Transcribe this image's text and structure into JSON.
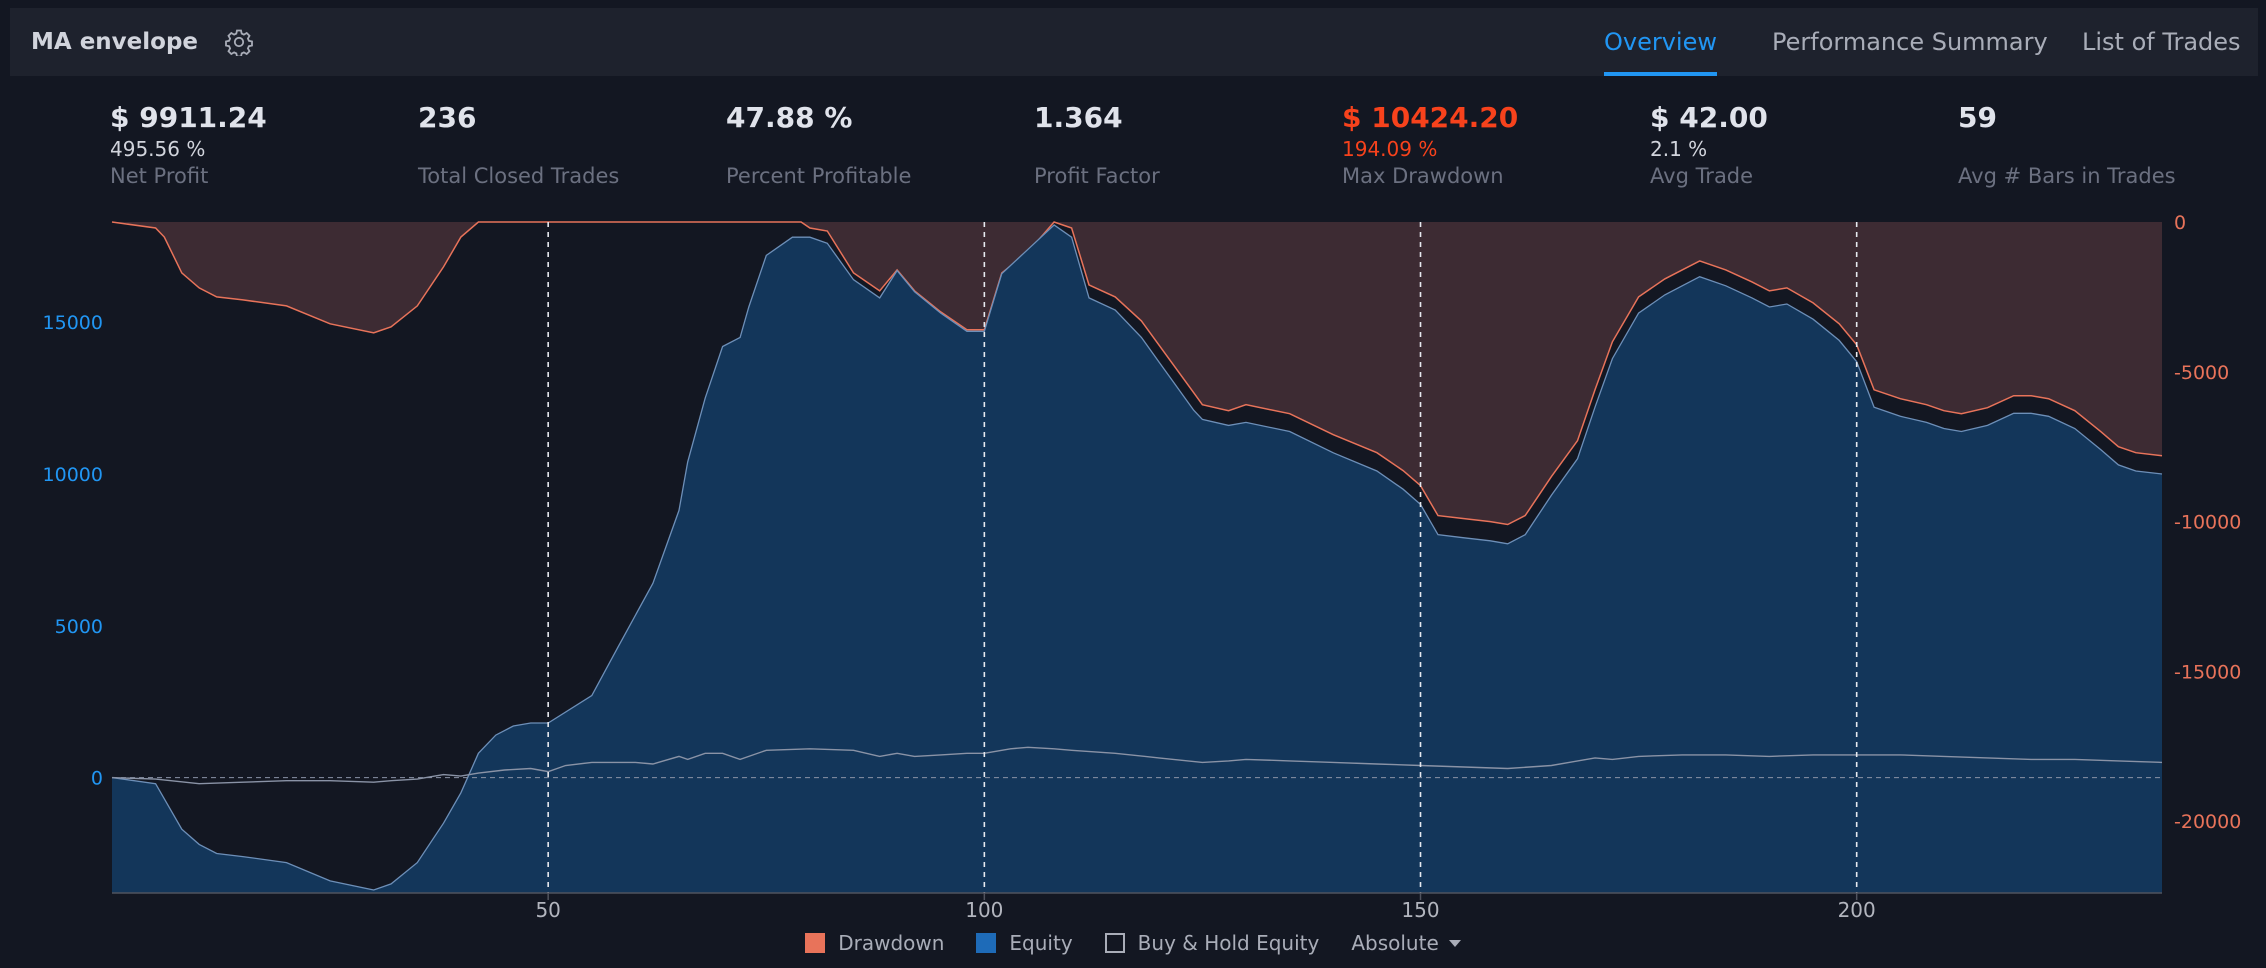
{
  "header": {
    "strategy_name": "MA envelope",
    "tabs": [
      {
        "label": "Overview",
        "active": true
      },
      {
        "label": "Performance Summary",
        "active": false
      },
      {
        "label": "List of Trades",
        "active": false
      }
    ]
  },
  "stats": [
    {
      "value": "$ 9911.24",
      "sub": "495.56 %",
      "label": "Net Profit"
    },
    {
      "value": "236",
      "sub": "",
      "label": "Total Closed Trades"
    },
    {
      "value": "47.88 %",
      "sub": "",
      "label": "Percent Profitable"
    },
    {
      "value": "1.364",
      "sub": "",
      "label": "Profit Factor"
    },
    {
      "value": "$ 10424.20",
      "sub": "194.09 %",
      "label": "Max Drawdown"
    },
    {
      "value": "$ 42.00",
      "sub": "2.1 %",
      "label": "Avg Trade"
    },
    {
      "value": "59",
      "sub": "",
      "label": "Avg # Bars in Trades"
    }
  ],
  "legend": {
    "drawdown": "Drawdown",
    "equity": "Equity",
    "buy_hold": "Buy & Hold Equity",
    "mode": "Absolute"
  },
  "colors": {
    "accent": "#2196f3",
    "negative": "#f7421c",
    "equity_fill": "#13365a",
    "drawdown_fill": "#3d2b33",
    "drawdown_line": "#e8735a"
  },
  "chart_data": {
    "type": "area",
    "x_ticks": [
      50,
      100,
      150,
      200
    ],
    "xlim": [
      0,
      235
    ],
    "y_left_ticks": [
      0,
      5000,
      10000,
      15000
    ],
    "y_left_lim": [
      -3800,
      18300
    ],
    "y_right_ticks": [
      0,
      -5000,
      -10000,
      -15000,
      -20000
    ],
    "y_right_lim": [
      -22400,
      0
    ],
    "series": [
      {
        "name": "Equity",
        "axis": "left",
        "x": [
          0,
          5,
          8,
          10,
          12,
          15,
          20,
          25,
          30,
          32,
          35,
          38,
          40,
          42,
          44,
          46,
          48,
          50,
          55,
          58,
          62,
          65,
          66,
          68,
          70,
          72,
          73,
          75,
          78,
          80,
          82,
          85,
          88,
          90,
          92,
          95,
          98,
          100,
          102,
          105,
          108,
          110,
          112,
          115,
          118,
          120,
          124,
          125,
          128,
          130,
          135,
          140,
          145,
          148,
          150,
          152,
          155,
          158,
          160,
          162,
          165,
          168,
          170,
          172,
          175,
          178,
          180,
          182,
          185,
          188,
          190,
          192,
          195,
          198,
          200,
          202,
          205,
          208,
          210,
          212,
          215,
          218,
          220,
          222,
          225,
          228,
          230,
          232,
          235
        ],
        "values": [
          0,
          -200,
          -1700,
          -2200,
          -2500,
          -2600,
          -2800,
          -3400,
          -3700,
          -3500,
          -2800,
          -1500,
          -500,
          800,
          1400,
          1700,
          1800,
          1800,
          2700,
          4300,
          6400,
          8800,
          10400,
          12500,
          14200,
          14500,
          15500,
          17200,
          17800,
          17800,
          17600,
          16400,
          15800,
          16700,
          16000,
          15300,
          14700,
          14700,
          16600,
          17400,
          18200,
          17800,
          15800,
          15400,
          14500,
          13700,
          12100,
          11800,
          11600,
          11700,
          11400,
          10700,
          10100,
          9500,
          9000,
          8000,
          7900,
          7800,
          7700,
          8000,
          9300,
          10500,
          12200,
          13800,
          15300,
          15900,
          16200,
          16500,
          16200,
          15800,
          15500,
          15600,
          15100,
          14400,
          13700,
          12200,
          11900,
          11700,
          11500,
          11400,
          11600,
          12000,
          12000,
          11900,
          11500,
          10800,
          10300,
          10100,
          10000
        ]
      },
      {
        "name": "Drawdown",
        "axis": "right",
        "x": [
          0,
          5,
          6,
          8,
          10,
          12,
          15,
          20,
          25,
          30,
          32,
          35,
          38,
          40,
          42,
          44,
          45,
          50,
          60,
          79,
          80,
          82,
          85,
          88,
          90,
          92,
          95,
          98,
          100,
          102,
          105,
          108,
          110,
          112,
          115,
          118,
          120,
          124,
          125,
          128,
          130,
          135,
          140,
          145,
          148,
          150,
          152,
          155,
          158,
          160,
          162,
          165,
          168,
          170,
          172,
          175,
          178,
          180,
          182,
          185,
          188,
          190,
          192,
          195,
          198,
          200,
          202,
          205,
          208,
          210,
          212,
          215,
          218,
          220,
          222,
          225,
          228,
          230,
          232,
          235
        ],
        "values": [
          0,
          -200,
          -500,
          -1700,
          -2200,
          -2500,
          -2600,
          -2800,
          -3400,
          -3700,
          -3500,
          -2800,
          -1500,
          -500,
          0,
          0,
          0,
          0,
          0,
          0,
          -200,
          -300,
          -1700,
          -2300,
          -1600,
          -2300,
          -3000,
          -3600,
          -3600,
          -1700,
          -1000,
          0,
          -200,
          -2100,
          -2500,
          -3300,
          -4100,
          -5700,
          -6100,
          -6300,
          -6100,
          -6400,
          -7100,
          -7700,
          -8300,
          -8800,
          -9800,
          -9900,
          -10000,
          -10100,
          -9800,
          -8500,
          -7300,
          -5600,
          -4000,
          -2500,
          -1900,
          -1600,
          -1300,
          -1600,
          -2000,
          -2300,
          -2200,
          -2700,
          -3400,
          -4100,
          -5600,
          -5900,
          -6100,
          -6300,
          -6400,
          -6200,
          -5800,
          -5800,
          -5900,
          -6300,
          -7000,
          -7500,
          -7700,
          -7800
        ]
      },
      {
        "name": "Buy & Hold Equity",
        "axis": "left",
        "x": [
          0,
          5,
          10,
          15,
          20,
          25,
          30,
          32,
          35,
          38,
          40,
          42,
          45,
          48,
          50,
          52,
          55,
          60,
          62,
          65,
          66,
          68,
          70,
          72,
          75,
          80,
          85,
          88,
          90,
          92,
          95,
          98,
          100,
          103,
          105,
          108,
          110,
          115,
          120,
          125,
          128,
          130,
          135,
          140,
          145,
          150,
          155,
          160,
          165,
          170,
          172,
          175,
          180,
          185,
          190,
          195,
          200,
          205,
          210,
          215,
          220,
          225,
          230,
          235
        ],
        "values": [
          0,
          -50,
          -200,
          -150,
          -100,
          -100,
          -150,
          -100,
          -50,
          100,
          50,
          150,
          250,
          300,
          200,
          400,
          500,
          500,
          450,
          700,
          600,
          800,
          800,
          600,
          900,
          950,
          900,
          700,
          800,
          700,
          750,
          800,
          800,
          950,
          1000,
          950,
          900,
          800,
          650,
          500,
          550,
          600,
          550,
          500,
          450,
          400,
          350,
          300,
          400,
          650,
          600,
          700,
          750,
          750,
          700,
          750,
          750,
          750,
          700,
          650,
          600,
          600,
          550,
          500
        ]
      }
    ],
    "grid": "vertical dashed at x ticks; horizontal dashed zero line",
    "legend_position": "bottom-center"
  }
}
